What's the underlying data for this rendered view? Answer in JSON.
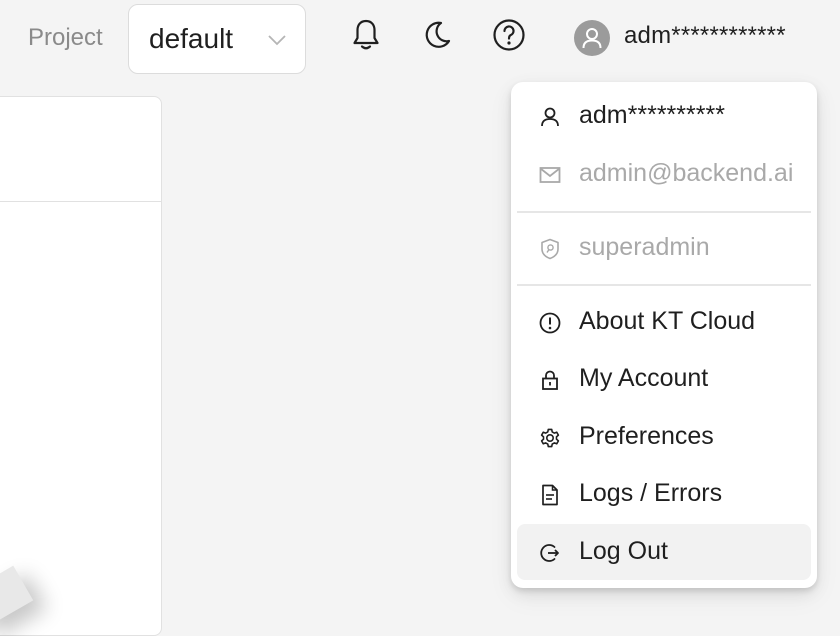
{
  "header": {
    "project_label": "Project",
    "project_value": "default",
    "icons": [
      "bell-icon",
      "moon-icon",
      "help-icon"
    ],
    "user_name": "adm************"
  },
  "user_menu": {
    "items": [
      {
        "label": "adm**********",
        "icon": "user-icon",
        "muted": false
      },
      {
        "label": "admin@backend.ai",
        "icon": "mail-icon",
        "muted": true
      },
      {
        "label": "superadmin",
        "icon": "shield-key-icon",
        "muted": true
      },
      {
        "label": "About KT Cloud",
        "icon": "info-icon",
        "muted": false
      },
      {
        "label": "My Account",
        "icon": "lock-icon",
        "muted": false
      },
      {
        "label": "Preferences",
        "icon": "gear-icon",
        "muted": false
      },
      {
        "label": "Logs / Errors",
        "icon": "file-text-icon",
        "muted": false
      },
      {
        "label": "Log Out",
        "icon": "logout-icon",
        "muted": false,
        "hovered": true
      }
    ]
  },
  "colors": {
    "background": "#f4f4f4",
    "panel": "#ffffff",
    "muted_text": "#a9a9a9",
    "hover_row": "#f2f2f2"
  }
}
